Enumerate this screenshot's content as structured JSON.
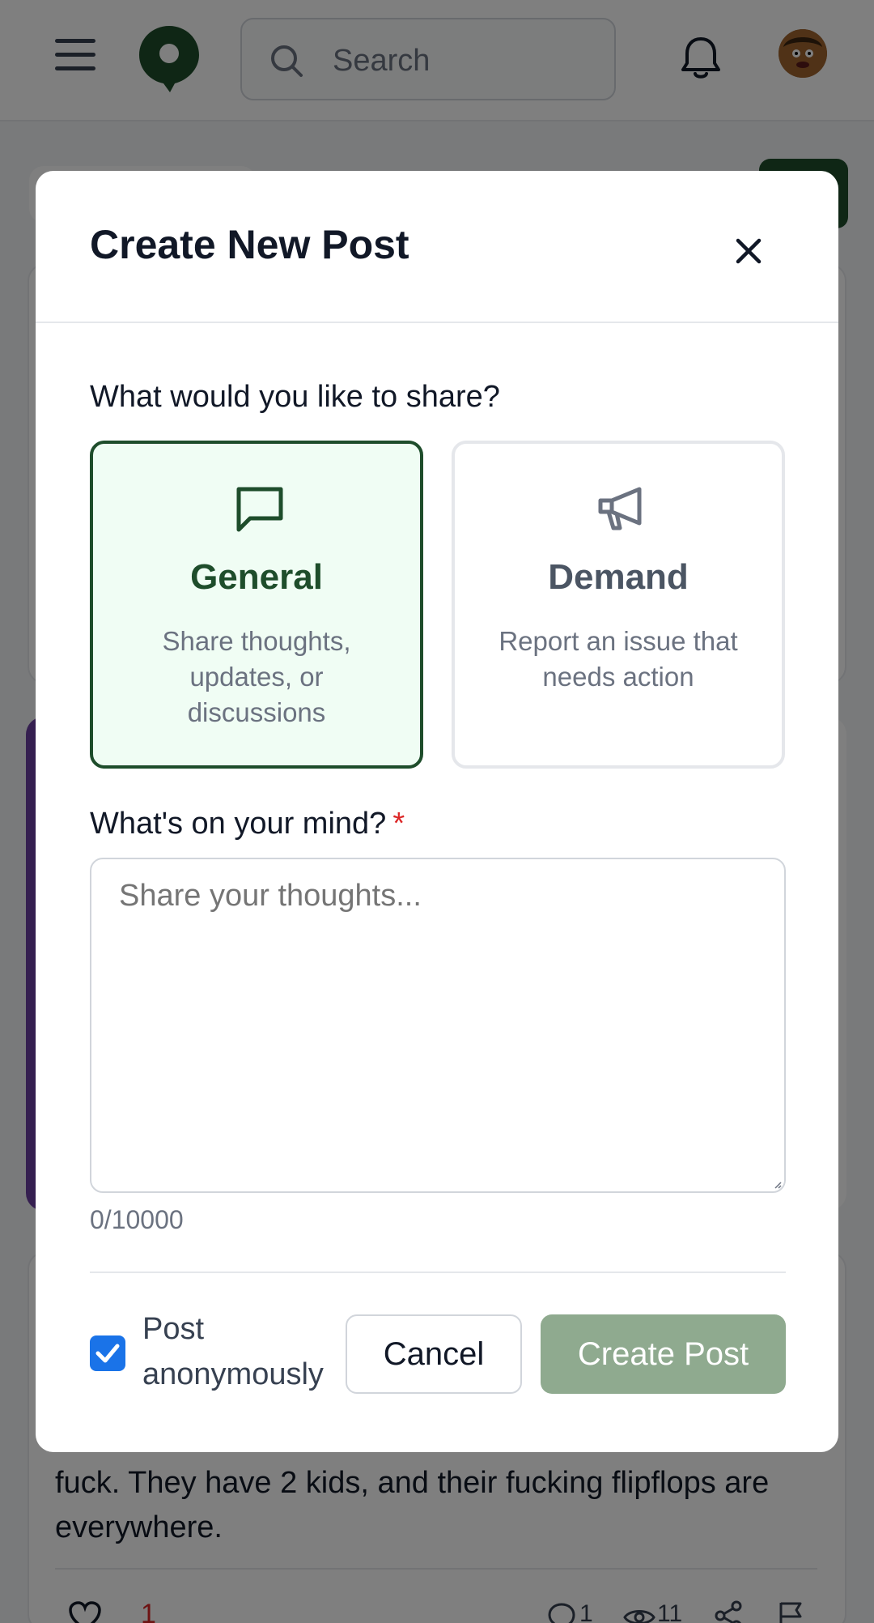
{
  "header": {
    "search_placeholder": "Search"
  },
  "background_post": {
    "text": "fuck. They have 2 kids, and their fucking flipflops are everywhere.",
    "like_count": "1",
    "comment_count": "1",
    "view_count": "11"
  },
  "modal": {
    "title": "Create New Post",
    "share_prompt": "What would you like to share?",
    "post_types": [
      {
        "name": "General",
        "description": "Share thoughts, updates, or discussions",
        "icon": "message-square-icon",
        "selected": true
      },
      {
        "name": "Demand",
        "description": "Report an issue that needs action",
        "icon": "megaphone-icon",
        "selected": false
      }
    ],
    "content_label": "What's on your mind?",
    "required_marker": "*",
    "content_placeholder": "Share your thoughts...",
    "char_count": "0/10000",
    "anonymous_label": "Post anonymously",
    "anonymous_checked": true,
    "cancel_label": "Cancel",
    "submit_label": "Create Post"
  },
  "colors": {
    "brand_green": "#1e4d2b",
    "selected_bg": "#f0fdf4",
    "submit_disabled": "#8faa8f",
    "checkbox_blue": "#1a73e8",
    "required_red": "#dc2626",
    "accent_purple": "#6b3fa0"
  }
}
